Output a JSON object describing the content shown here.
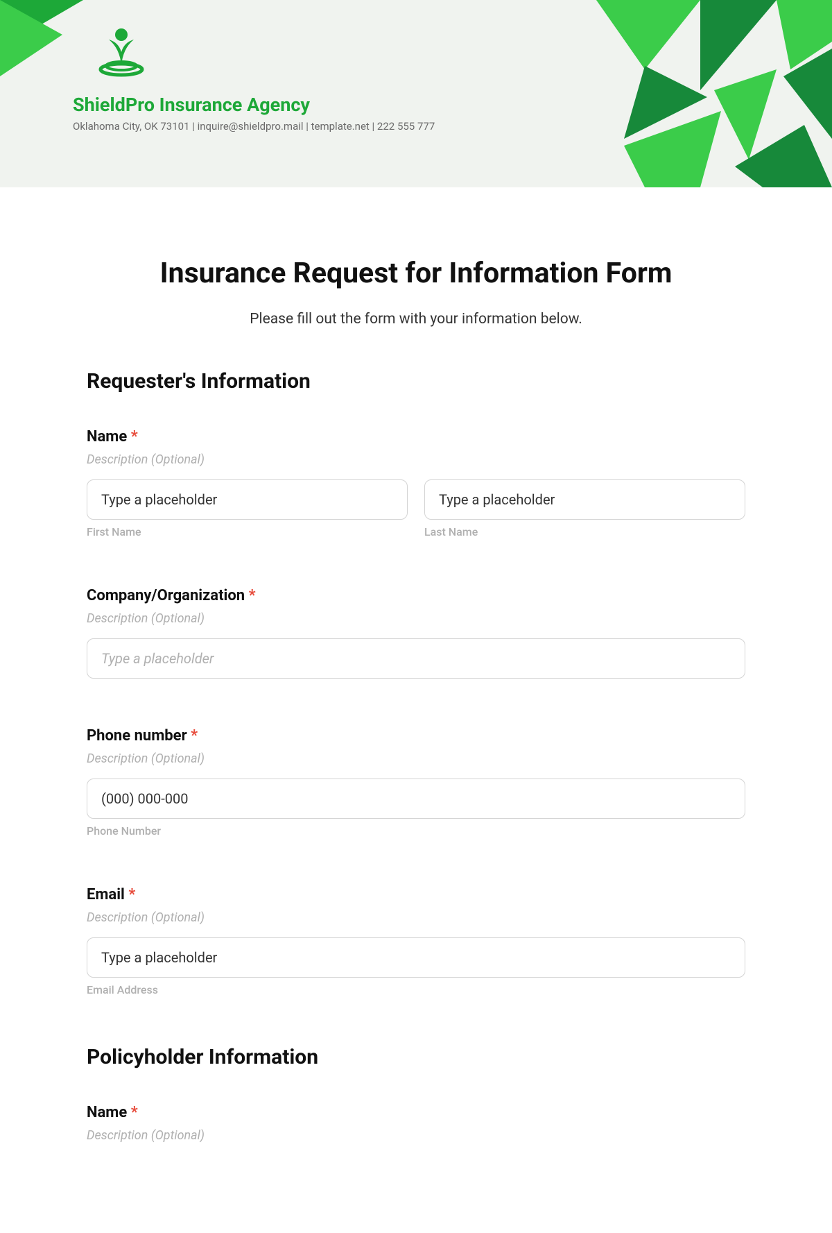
{
  "header": {
    "company_name": "ShieldPro Insurance Agency",
    "contact_line": "Oklahoma City, OK 73101 | inquire@shieldpro.mail | template.net | 222 555 777"
  },
  "form": {
    "title": "Insurance Request for Information Form",
    "subtitle": "Please fill out the form with your information below."
  },
  "sections": {
    "requester": {
      "heading": "Requester's Information",
      "name": {
        "label": "Name",
        "required": "*",
        "description": "Description (Optional)",
        "first_placeholder": "Type a placeholder",
        "first_sublabel": "First Name",
        "last_placeholder": "Type a placeholder",
        "last_sublabel": "Last Name"
      },
      "company": {
        "label": "Company/Organization",
        "required": "*",
        "description": "Description (Optional)",
        "placeholder": "Type a placeholder"
      },
      "phone": {
        "label": "Phone number",
        "required": "*",
        "description": "Description (Optional)",
        "placeholder": "(000) 000-000",
        "sublabel": "Phone Number"
      },
      "email": {
        "label": "Email",
        "required": "*",
        "description": "Description (Optional)",
        "placeholder": "Type a placeholder",
        "sublabel": "Email Address"
      }
    },
    "policyholder": {
      "heading": "Policyholder Information",
      "name": {
        "label": "Name",
        "required": "*",
        "description": "Description (Optional)"
      }
    }
  }
}
